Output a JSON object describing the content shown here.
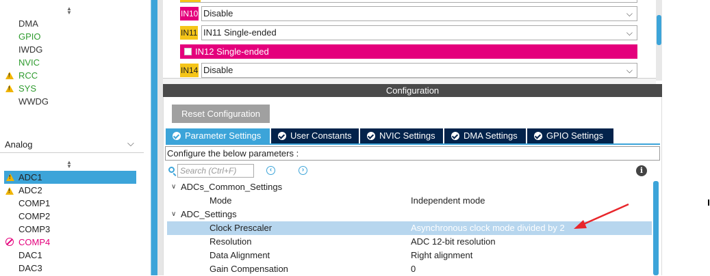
{
  "sidebar": {
    "top_items": [
      {
        "label": "DMA",
        "color": "#333333",
        "warning": false
      },
      {
        "label": "GPIO",
        "color": "#2e9b2e",
        "warning": false
      },
      {
        "label": "IWDG",
        "color": "#333333",
        "warning": false
      },
      {
        "label": "NVIC",
        "color": "#2e9b2e",
        "warning": false
      },
      {
        "label": "RCC",
        "color": "#2e9b2e",
        "warning": true
      },
      {
        "label": "SYS",
        "color": "#2e9b2e",
        "warning": true
      },
      {
        "label": "WWDG",
        "color": "#333333",
        "warning": false
      }
    ],
    "category": "Analog",
    "analog_items": [
      {
        "label": "ADC1",
        "state": "selected-warning"
      },
      {
        "label": "ADC2",
        "state": "warning"
      },
      {
        "label": "COMP1",
        "state": "normal"
      },
      {
        "label": "COMP2",
        "state": "normal"
      },
      {
        "label": "COMP3",
        "state": "normal"
      },
      {
        "label": "COMP4",
        "state": "disabled"
      },
      {
        "label": "DAC1",
        "state": "normal"
      },
      {
        "label": "DAC3",
        "state": "normal"
      }
    ]
  },
  "inputs": {
    "in10": {
      "label": "IN10",
      "value": "Disable",
      "label_color": "#e4007c"
    },
    "in11": {
      "label": "IN11",
      "value": "IN11 Single-ended",
      "label_color": "#f5c518"
    },
    "in12": {
      "label": "IN12 Single-ended"
    },
    "in14": {
      "label": "IN14",
      "value": "Disable",
      "label_color": "#f5c518"
    }
  },
  "config": {
    "title": "Configuration",
    "reset_label": "Reset Configuration",
    "tabs": [
      {
        "label": "Parameter Settings",
        "active": true
      },
      {
        "label": "User Constants",
        "active": false
      },
      {
        "label": "NVIC Settings",
        "active": false
      },
      {
        "label": "DMA Settings",
        "active": false
      },
      {
        "label": "GPIO Settings",
        "active": false
      }
    ],
    "configure_text": "Configure the below parameters :",
    "search_placeholder": "Search (Ctrl+F)",
    "info_glyph": "i",
    "prev_glyph": "‹",
    "next_glyph": "›",
    "tree": [
      {
        "type": "group",
        "label": "ADCs_Common_Settings"
      },
      {
        "type": "param",
        "key": "Mode",
        "value": "Independent mode"
      },
      {
        "type": "group",
        "label": "ADC_Settings"
      },
      {
        "type": "param",
        "key": "Clock Prescaler",
        "value": "Asynchronous clock mode divided by 2",
        "selected": true
      },
      {
        "type": "param",
        "key": "Resolution",
        "value": "ADC 12-bit resolution"
      },
      {
        "type": "param",
        "key": "Data Alignment",
        "value": "Right alignment"
      },
      {
        "type": "param",
        "key": "Gain Compensation",
        "value": "0"
      }
    ]
  },
  "accent_color": "#3ca4d9",
  "annotation_arrow_color": "#e8262b"
}
